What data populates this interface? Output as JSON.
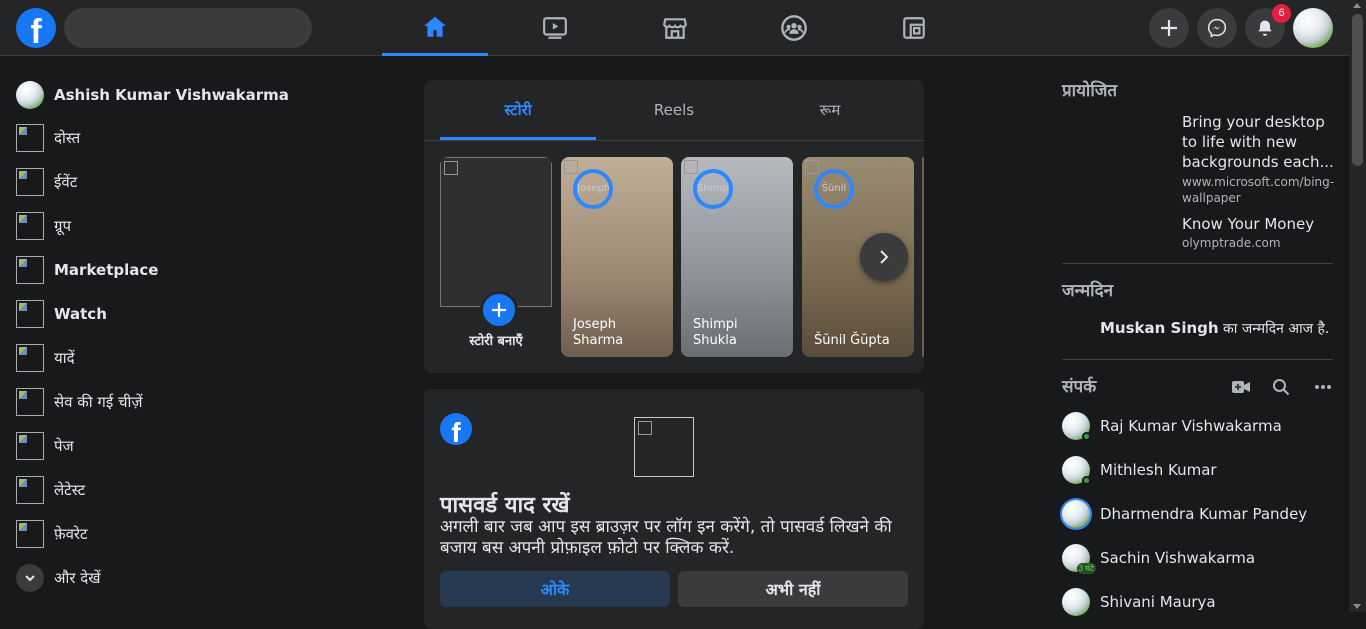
{
  "topbar": {
    "logo_letter": "f",
    "search_placeholder": "",
    "nav": [
      "home-icon",
      "watch-icon",
      "marketplace-icon",
      "groups-icon",
      "gaming-icon"
    ],
    "notification_count": "6"
  },
  "sidebar": {
    "profile_name": "Ashish Kumar Vishwakarma",
    "items": [
      {
        "label": "दोस्त"
      },
      {
        "label": "ईवेंट"
      },
      {
        "label": "ग्रूप"
      },
      {
        "label": "Marketplace"
      },
      {
        "label": "Watch"
      },
      {
        "label": "यादें"
      },
      {
        "label": "सेव की गई चीज़ें"
      },
      {
        "label": "पेज"
      },
      {
        "label": "लेटेस्ट"
      },
      {
        "label": "फ़ेवरेट"
      }
    ],
    "see_more": "और देखें"
  },
  "stories": {
    "tabs": [
      "स्टोरी",
      "Reels",
      "रूम"
    ],
    "create_label": "स्टोरी बनाएँ",
    "items": [
      {
        "name": "Joseph Sharma",
        "alt": "Joseph"
      },
      {
        "name": "Shimpi Shukla",
        "alt": "Shimpi"
      },
      {
        "name": "Šŭnil Ğŭpta",
        "alt": "Šŭnil"
      }
    ]
  },
  "password_card": {
    "title": "पासवर्ड याद रखें",
    "body": "अगली बार जब आप इस ब्राउज़र पर लॉग इन करेंगे, तो पासवर्ड लिखने की बजाय बस अपनी प्रोफ़ाइल फ़ोटो पर क्लिक करें.",
    "ok": "ओके",
    "not_now": "अभी नहीं"
  },
  "right": {
    "sponsored_heading": "प्रायोजित",
    "ads": [
      {
        "title": "Bring your desktop to life with new backgrounds each...",
        "url": "www.microsoft.com/bing-wallpaper"
      },
      {
        "title": "Know Your Money",
        "url": "olymptrade.com"
      }
    ],
    "birthdays_heading": "जन्मदिन",
    "birthday_name": "Muskan Singh",
    "birthday_text": "का जन्मदिन आज है.",
    "contacts_heading": "संपर्क",
    "contacts": [
      {
        "name": "Raj Kumar Vishwakarma"
      },
      {
        "name": "Mithlesh Kumar"
      },
      {
        "name": "Dharmendra Kumar Pandey"
      },
      {
        "name": "Sachin Vishwakarma",
        "ago": "3 घंटे"
      },
      {
        "name": "Shivani Maurya"
      }
    ]
  },
  "colors": {
    "accent": "#2d88ff",
    "brand": "#1877f2",
    "bg": "#18191a",
    "surface": "#242526"
  }
}
